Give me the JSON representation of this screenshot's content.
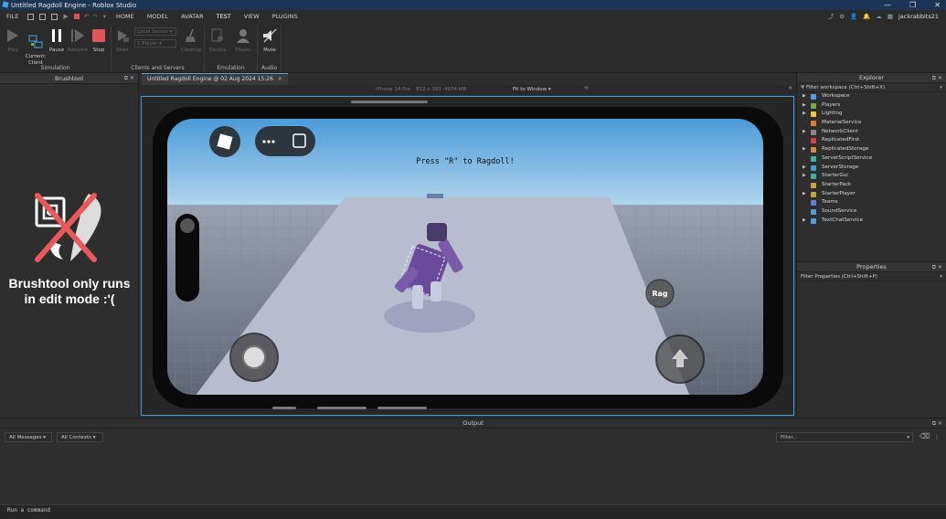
{
  "window": {
    "title": "Untitled Ragdoll Engine - Roblox Studio",
    "controls": [
      "—",
      "❐",
      "✕"
    ]
  },
  "menubar": {
    "file": "FILE",
    "tabs": [
      "HOME",
      "MODEL",
      "AVATAR",
      "TEST",
      "VIEW",
      "PLUGINS"
    ],
    "active_tab": "TEST",
    "username": "jackrabbits21"
  },
  "ribbon": {
    "play": "Play",
    "current_client": "Current:\nClient",
    "pause": "Pause",
    "resume": "Resume",
    "stop": "Stop",
    "simulation_label": "Simulation",
    "start": "Start",
    "server_select": "Local Server",
    "players_select": "1 Player",
    "clients_label": "Clients and Servers",
    "cleanup": "Cleanup",
    "device": "Device",
    "player": "Player",
    "emulation_label": "Emulation",
    "mute": "Mute",
    "audio_label": "Audio"
  },
  "brushtool": {
    "panel_title": "Brushtool",
    "message_line1": "Brushtool only runs",
    "message_line2": "in edit mode :'("
  },
  "viewport": {
    "tab_title": "Untitled Ragdoll Engine @ 02 Aug 2024 15:26",
    "device_name": "iPhone 14 Pro",
    "resolution": "852 x 393",
    "memory": "4974 MB",
    "fit_mode": "Fit to Window",
    "game_message": "Press \"R\" to Ragdoll!",
    "rag_button": "Rag"
  },
  "explorer": {
    "title": "Explorer",
    "filter": "Filter workspace (Ctrl+Shift+X)",
    "items": [
      {
        "label": "Workspace",
        "expandable": true,
        "color": "#4aa3df"
      },
      {
        "label": "Players",
        "expandable": true,
        "color": "#6ab04c"
      },
      {
        "label": "Lighting",
        "expandable": true,
        "color": "#f5c542"
      },
      {
        "label": "MaterialService",
        "expandable": false,
        "color": "#e07b39"
      },
      {
        "label": "NetworkClient",
        "expandable": true,
        "color": "#8a8a8a"
      },
      {
        "label": "ReplicatedFirst",
        "expandable": false,
        "color": "#d94040"
      },
      {
        "label": "ReplicatedStorage",
        "expandable": true,
        "color": "#d98c40"
      },
      {
        "label": "ServerScriptService",
        "expandable": false,
        "color": "#3fb0a8"
      },
      {
        "label": "ServerStorage",
        "expandable": true,
        "color": "#3fa0c8"
      },
      {
        "label": "StarterGui",
        "expandable": true,
        "color": "#3fb0a8"
      },
      {
        "label": "StarterPack",
        "expandable": false,
        "color": "#c8a040"
      },
      {
        "label": "StarterPlayer",
        "expandable": true,
        "color": "#c8a040"
      },
      {
        "label": "Teams",
        "expandable": false,
        "color": "#5a7fd6"
      },
      {
        "label": "SoundService",
        "expandable": false,
        "color": "#4aa3df"
      },
      {
        "label": "TextChatService",
        "expandable": true,
        "color": "#4aa3df"
      }
    ]
  },
  "properties": {
    "title": "Properties",
    "filter": "Filter Properties (Ctrl+Shift+P)"
  },
  "output": {
    "title": "Output",
    "messages_select": "All Messages",
    "contexts_select": "All Contexts",
    "filter_placeholder": "Filter..."
  },
  "command_bar": {
    "placeholder": "Run a command"
  }
}
